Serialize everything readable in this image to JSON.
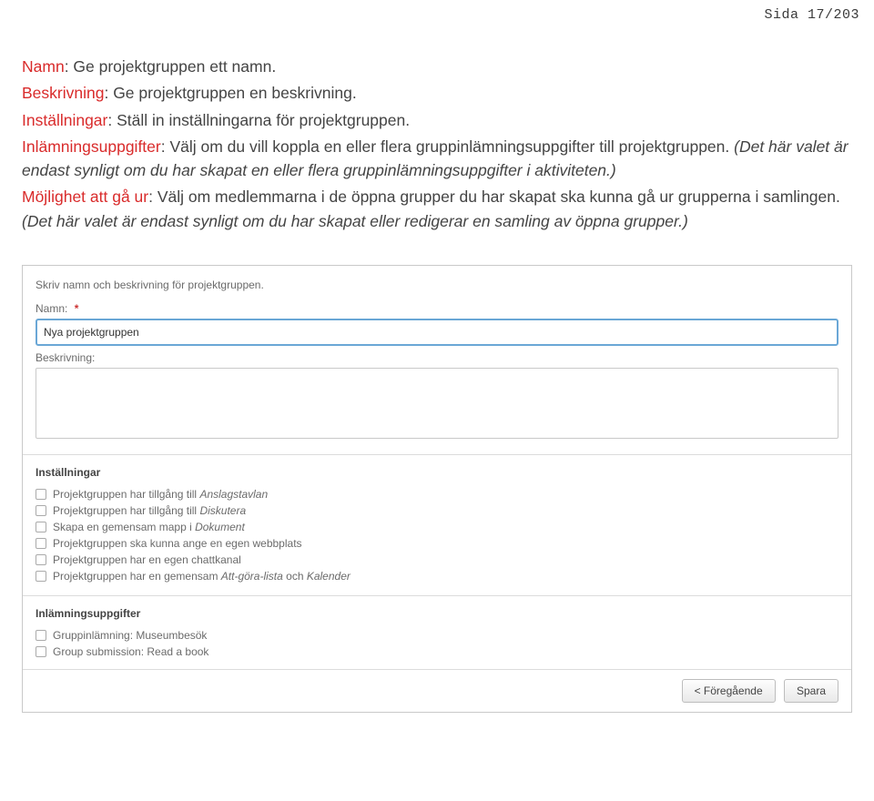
{
  "page_indicator": "Sida 17/203",
  "doc": {
    "p1": {
      "term": "Namn",
      "text": ": Ge projektgruppen ett namn."
    },
    "p2": {
      "term": "Beskrivning",
      "text": ": Ge projektgruppen en beskrivning."
    },
    "p3": {
      "term": "Inställningar",
      "text": ": Ställ in inställningarna för projektgruppen."
    },
    "p4": {
      "term": "Inlämningsuppgifter",
      "text": ": Välj om du vill koppla en eller flera gruppinlämningsuppgifter till projektgruppen. ",
      "italic": "(Det här valet är endast synligt om du har skapat en eller flera gruppinlämningsuppgifter i aktiviteten.)"
    },
    "p5": {
      "term": "Möjlighet att gå ur",
      "text": ": Välj om medlemmarna i de öppna grupper du har skapat ska kunna gå ur grupperna i samlingen. ",
      "italic": "(Det här valet är endast synligt om du har skapat eller redigerar en samling av öppna grupper.)"
    }
  },
  "form": {
    "intro": "Skriv namn och beskrivning för projektgruppen.",
    "name_label": "Namn:",
    "required_mark": "*",
    "name_value": "Nya projektgruppen",
    "desc_label": "Beskrivning:",
    "desc_value": "",
    "settings_title": "Inställningar",
    "settings": [
      {
        "pre": "Projektgruppen har tillgång till ",
        "em": "Anslagstavlan",
        "post": ""
      },
      {
        "pre": "Projektgruppen har tillgång till ",
        "em": "Diskutera",
        "post": ""
      },
      {
        "pre": "Skapa en gemensam mapp i ",
        "em": "Dokument",
        "post": ""
      },
      {
        "pre": "Projektgruppen ska kunna ange en egen webbplats",
        "em": "",
        "post": ""
      },
      {
        "pre": "Projektgruppen har en egen chattkanal",
        "em": "",
        "post": ""
      },
      {
        "pre": "Projektgruppen har en gemensam ",
        "em": "Att-göra-lista",
        "post": " och ",
        "em2": "Kalender"
      }
    ],
    "submissions_title": "Inlämningsuppgifter",
    "submissions": [
      {
        "label": "Gruppinlämning: Museumbesök"
      },
      {
        "label": "Group submission: Read a book"
      }
    ],
    "buttons": {
      "prev": "< Föregående",
      "save": "Spara"
    }
  }
}
